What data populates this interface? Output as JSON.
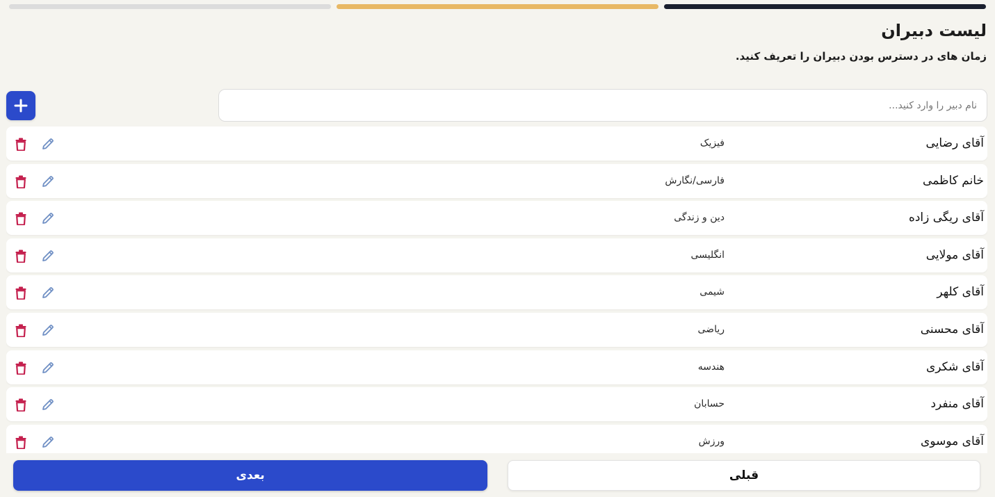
{
  "stepper": {
    "steps": [
      {
        "state": "pending",
        "color": "#dcdcdc"
      },
      {
        "state": "current",
        "color": "#e8b865"
      },
      {
        "state": "done",
        "color": "#1a1f2e"
      }
    ]
  },
  "header": {
    "title": "لیست دبیران",
    "subtitle": "زمان های در دسترس بودن دبیران را تعریف کنید."
  },
  "search": {
    "placeholder": "نام دبیر را وارد کنید...",
    "value": ""
  },
  "add_button": {
    "icon": "plus-icon",
    "color": "#2b4acb"
  },
  "teachers": [
    {
      "name": "آقای رضایی",
      "subject": "فیزیک"
    },
    {
      "name": "خانم کاظمی",
      "subject": "فارسی/نگارش"
    },
    {
      "name": "آقای ریگی زاده",
      "subject": "دین و زندگی"
    },
    {
      "name": "آقای مولایی",
      "subject": "انگلیسی"
    },
    {
      "name": "آقای کلهر",
      "subject": "شیمی"
    },
    {
      "name": "آقای محسنی",
      "subject": "ریاضی"
    },
    {
      "name": "آقای شکری",
      "subject": "هندسه"
    },
    {
      "name": "آقای منفرد",
      "subject": "حسابان"
    },
    {
      "name": "آقای موسوی",
      "subject": "ورزش"
    }
  ],
  "row_icons": {
    "delete": {
      "icon": "trash-icon",
      "color": "#c41f4d"
    },
    "edit": {
      "icon": "pencil-icon",
      "color": "#6f8fc4"
    }
  },
  "footer": {
    "next_label": "بعدی",
    "prev_label": "قبلی",
    "next_color": "#2b4acb"
  }
}
